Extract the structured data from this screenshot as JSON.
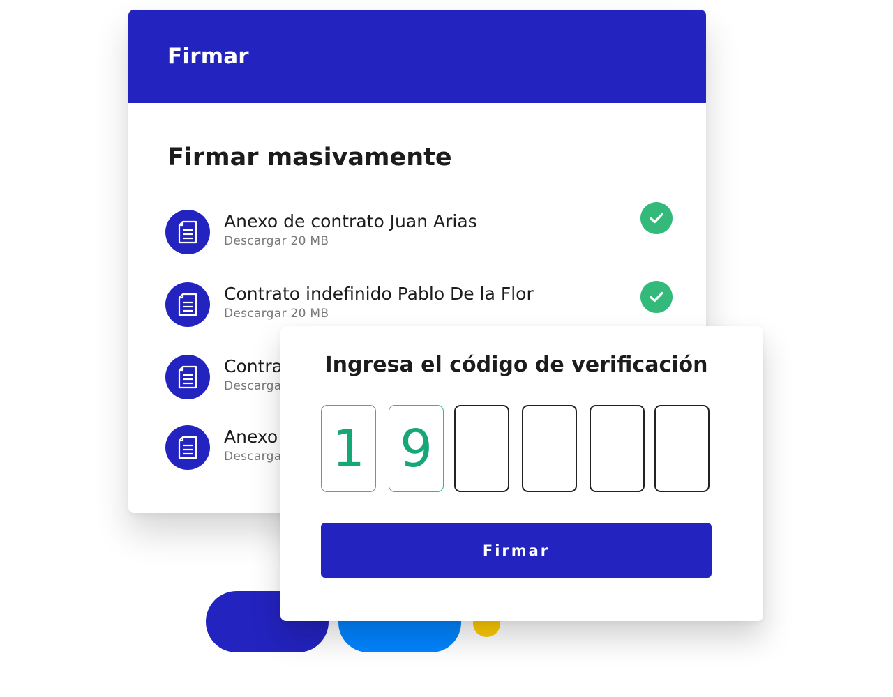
{
  "header": {
    "title": "Firmar"
  },
  "section": {
    "title": "Firmar masivamente"
  },
  "documents": [
    {
      "title": "Anexo de contrato Juan Arias",
      "subtitle": "Descargar 20 MB",
      "signed": true
    },
    {
      "title": "Contrato indefinido Pablo De la Flor",
      "subtitle": "Descargar 20 MB",
      "signed": true
    },
    {
      "title": "Contra",
      "subtitle": "Descarga",
      "signed": false
    },
    {
      "title": "Anexo",
      "subtitle": "Descarga",
      "signed": false
    }
  ],
  "verification": {
    "title": "Ingresa el código de verificación",
    "digits": [
      "1",
      "9",
      "",
      "",
      "",
      ""
    ],
    "button_label": "Firmar"
  },
  "icons": {
    "document": "document-icon",
    "check": "check-icon"
  },
  "colors": {
    "brand": "#2323c0",
    "success": "#33b97a",
    "accent_blue": "#0084ff",
    "accent_yellow": "#ffcc00",
    "code_digit": "#14a878"
  }
}
